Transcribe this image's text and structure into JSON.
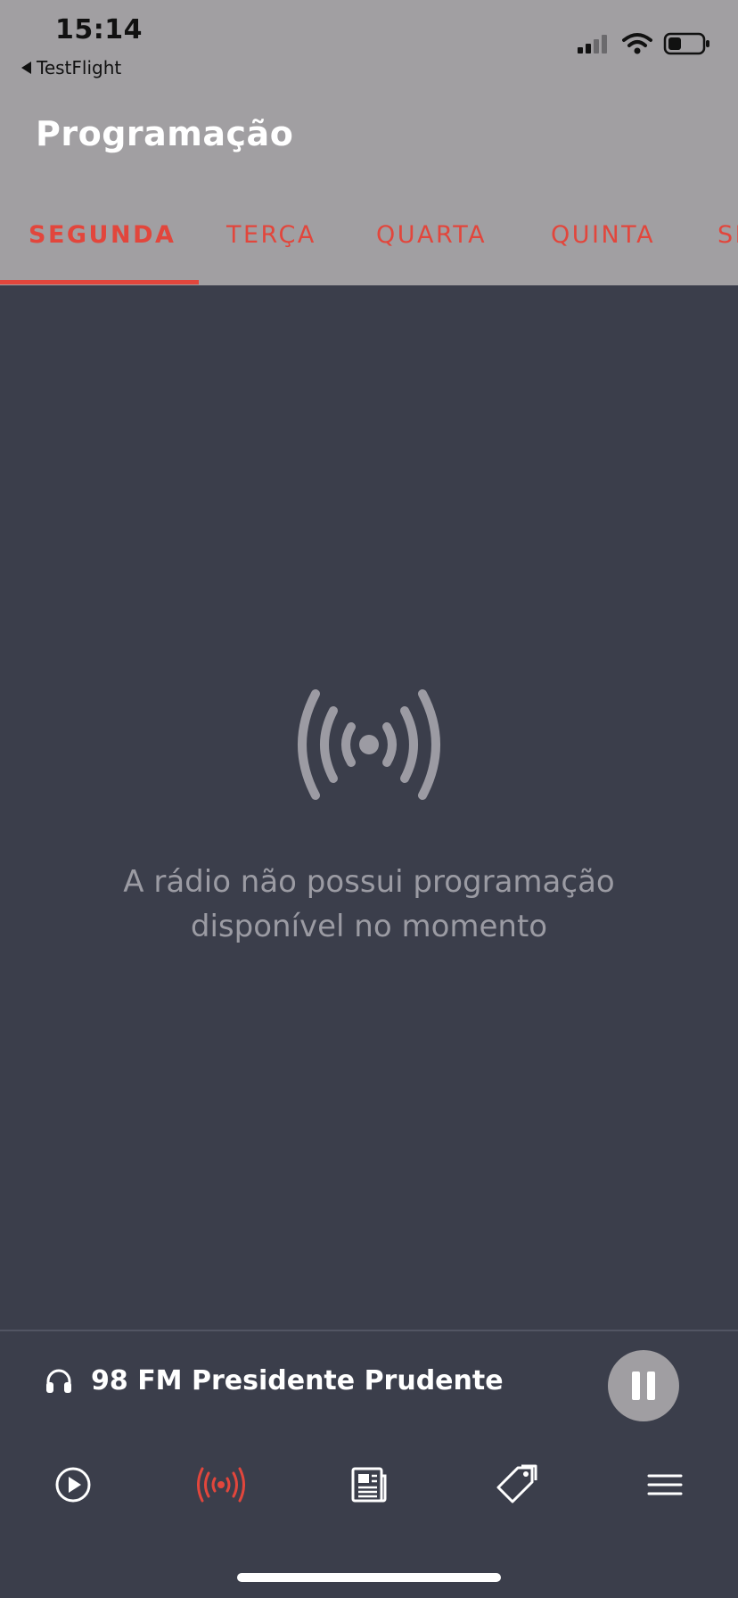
{
  "status_bar": {
    "time": "15:14",
    "back_app": "TestFlight"
  },
  "header": {
    "title": "Programação"
  },
  "tabs": [
    {
      "label": "SEGUNDA",
      "active": true
    },
    {
      "label": "TERÇA",
      "active": false
    },
    {
      "label": "QUARTA",
      "active": false
    },
    {
      "label": "QUINTA",
      "active": false
    },
    {
      "label": "SEXTA",
      "active": false
    }
  ],
  "empty_state": {
    "icon": "broadcast-icon",
    "message": "A rádio não possui programação disponível no momento"
  },
  "player": {
    "station_name": "98 FM Presidente Prudente",
    "state_icon": "pause-icon"
  },
  "bottom_nav": [
    {
      "icon": "play-icon",
      "active": false
    },
    {
      "icon": "broadcast-icon",
      "active": true
    },
    {
      "icon": "news-icon",
      "active": false
    },
    {
      "icon": "tag-icon",
      "active": false
    },
    {
      "icon": "menu-icon",
      "active": false
    }
  ],
  "colors": {
    "accent": "#e2463c",
    "header_bg": "#a19fa2",
    "content_bg": "#3b3e4b",
    "muted_text": "#9b9ba3"
  }
}
